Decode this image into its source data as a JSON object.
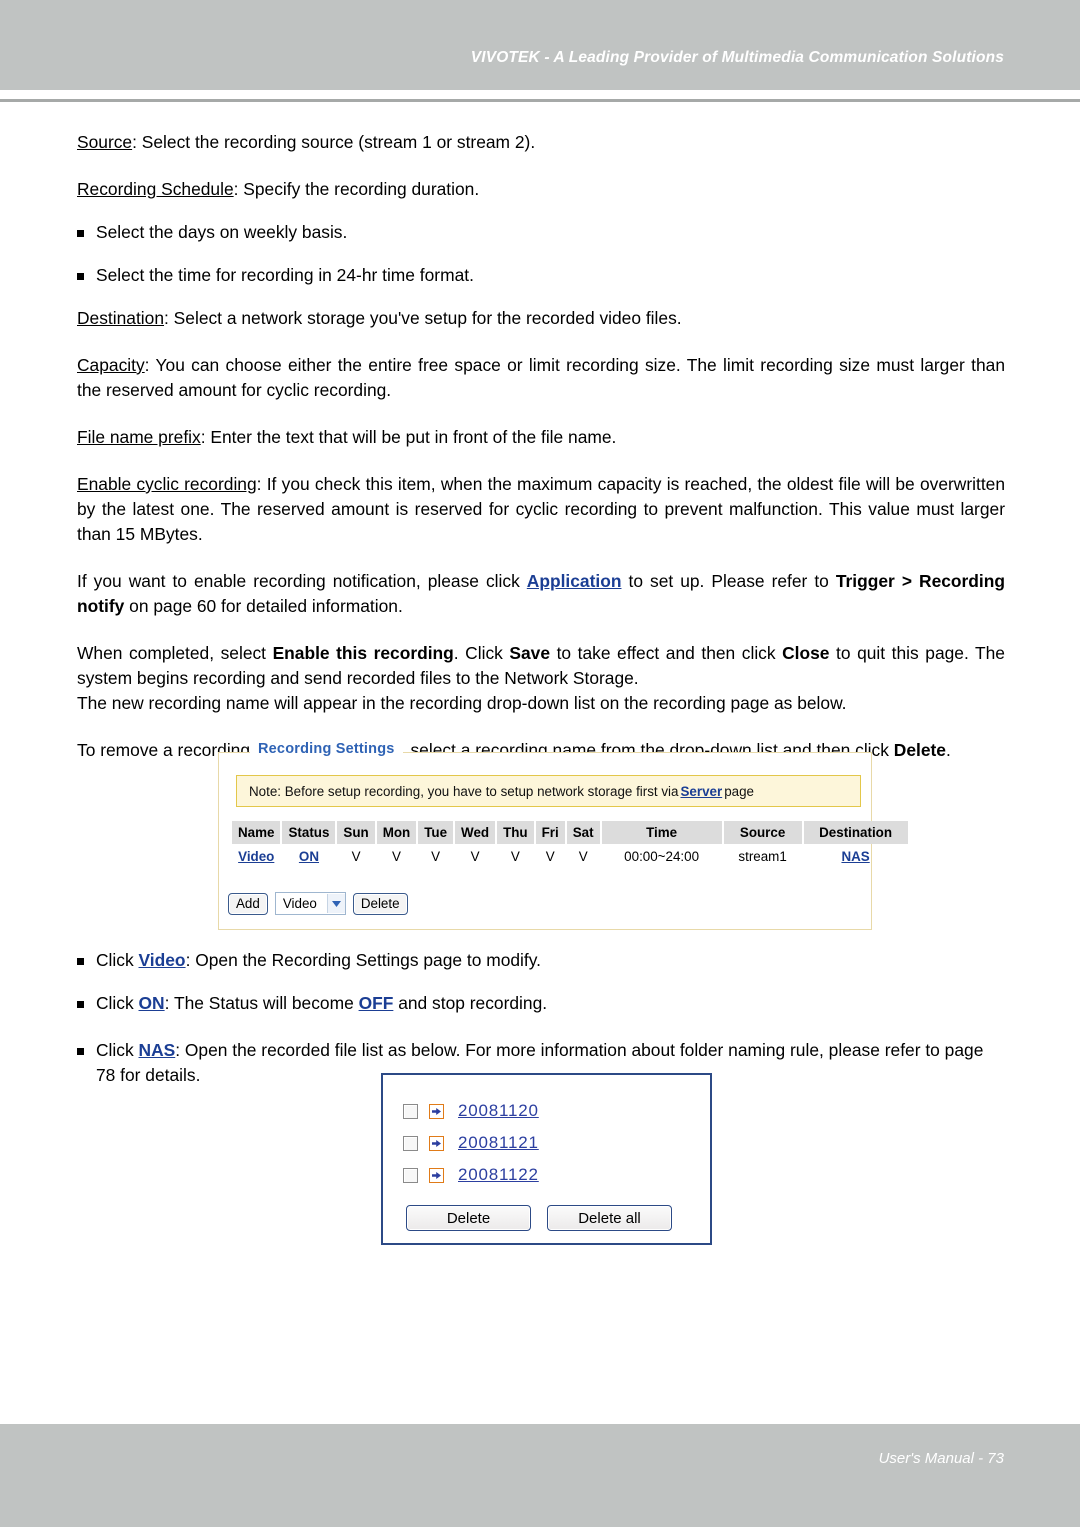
{
  "header": {
    "title": "VIVOTEK - A Leading Provider of Multimedia Communication Solutions"
  },
  "footer": {
    "text": "User's Manual - 73"
  },
  "body": {
    "p_source_term": "Source",
    "p_source_rest": ": Select the recording source (stream 1 or stream 2).",
    "p_schedule_term": "Recording Schedule",
    "p_schedule_rest": ": Specify the recording duration.",
    "bullet_days": "Select the days on weekly basis.",
    "bullet_time": "Select the time for recording in 24-hr time format.",
    "p_destination_term": "Destination",
    "p_destination_rest": ": Select a network storage you've setup for the recorded video files.",
    "p_capacity_term": "Capacity",
    "p_capacity_rest": ": You can choose either the entire free space or limit recording size. The limit recording size must larger than the reserved amount for cyclic recording.",
    "p_prefix_term": "File name prefix",
    "p_prefix_rest": ": Enter the text that will be put in front of the file name.",
    "p_cyclic_term": "Enable cyclic recording",
    "p_cyclic_rest": ": If you check this item, when the maximum capacity is reached, the oldest file will be overwritten by the latest one. The reserved amount is reserved for cyclic recording to prevent malfunction. This value must larger than 15 MBytes.",
    "p_notify_1": "If you want to enable recording notification, please click ",
    "p_notify_link": "Application",
    "p_notify_2": " to set up. Please refer to ",
    "p_notify_bold1": "Trigger >",
    "p_notify_bold2": "Recording notify",
    "p_notify_3": " on page 60 for detailed information.",
    "p_complete_1": "When completed, select ",
    "p_complete_b1": "Enable this recording",
    "p_complete_2": ". Click ",
    "p_complete_b2": "Save",
    "p_complete_3": " to take effect and then click ",
    "p_complete_b3": "Close",
    "p_complete_4": " to quit this page. The system begins recording and send recorded files to the Network Storage.",
    "p_complete_5": "The new recording name will appear in the recording drop-down list on the recording page as below.",
    "p_remove_1": "To remove a recording setting from the list, select a recording name from the drop-down list and then click ",
    "p_remove_b": "Delete",
    "p_remove_2": ".",
    "bullet_video_1": "Click ",
    "bullet_video_link": "Video",
    "bullet_video_2": ": Open the Recording Settings page to modify.",
    "bullet_on_1": "Click ",
    "bullet_on_link": "ON",
    "bullet_on_2": ": The Status will become ",
    "bullet_off_link": "OFF",
    "bullet_on_3": " and stop recording.",
    "bullet_nas_1": "Click ",
    "bullet_nas_link": "NAS",
    "bullet_nas_2": ": Open the recorded file list as below. For more information about folder naming rule, please refer to page 78 for details."
  },
  "recording_settings": {
    "legend": "Recording Settings",
    "note_prefix": "Note: Before setup recording, you have to setup network storage first via",
    "note_link": "Server",
    "note_suffix": "page",
    "columns": [
      "Name",
      "Status",
      "Sun",
      "Mon",
      "Tue",
      "Wed",
      "Thu",
      "Fri",
      "Sat",
      "Time",
      "Source",
      "Destination"
    ],
    "row": {
      "name": "Video",
      "status": "ON",
      "sun": "V",
      "mon": "V",
      "tue": "V",
      "wed": "V",
      "thu": "V",
      "fri": "V",
      "sat": "V",
      "time": "00:00~24:00",
      "source": "stream1",
      "destination": "NAS"
    },
    "add_label": "Add",
    "select_value": "Video",
    "delete_label": "Delete"
  },
  "file_list": {
    "items": [
      {
        "label": "20081120"
      },
      {
        "label": "20081121"
      },
      {
        "label": "20081122"
      }
    ],
    "delete_label": "Delete",
    "delete_all_label": "Delete all"
  },
  "colors": {
    "band_gray": "#c0c3c2",
    "link_blue": "#1b3e94",
    "legend_blue": "#2f63b5",
    "note_bg": "#fdf6da",
    "note_border": "#e3c74a",
    "panel_border": "#2c4a86",
    "arrow_orange": "#e07b18"
  }
}
